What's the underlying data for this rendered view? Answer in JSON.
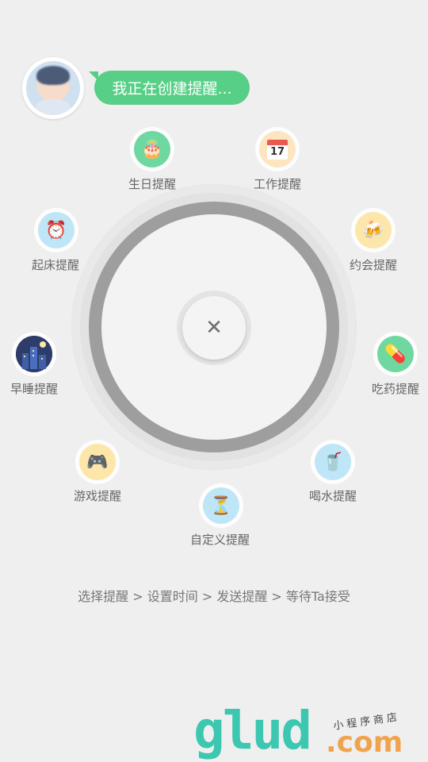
{
  "header": {
    "status_message": "我正在创建提醒..."
  },
  "dial": {
    "close_symbol": "✕"
  },
  "reminders": [
    {
      "label": "生日提醒",
      "icon": "birthday-cake-icon"
    },
    {
      "label": "工作提醒",
      "icon": "calendar-icon"
    },
    {
      "label": "起床提醒",
      "icon": "alarm-clock-icon"
    },
    {
      "label": "约会提醒",
      "icon": "beer-mugs-icon"
    },
    {
      "label": "早睡提醒",
      "icon": "night-city-icon"
    },
    {
      "label": "吃药提醒",
      "icon": "pill-icon"
    },
    {
      "label": "游戏提醒",
      "icon": "gamepad-icon"
    },
    {
      "label": "喝水提醒",
      "icon": "water-glass-icon"
    },
    {
      "label": "自定义提醒",
      "icon": "hourglass-icon"
    }
  ],
  "icons": {
    "cake": "🎂",
    "calendar": "📅",
    "alarm": "⏰",
    "beer": "🍻",
    "pill": "💊",
    "gamepad": "🎮",
    "water": "🥤",
    "hourglass": "⏳",
    "calendar_day": "17"
  },
  "steps_text": "选择提醒 > 设置时间 > 发送提醒 > 等待Ta接受",
  "watermark": {
    "brand": "glud",
    "domain": ".com",
    "tagline": "小程序商店"
  },
  "colors": {
    "background": "#efefef",
    "bubble": "#57cf86",
    "ring": "#9e9e9e"
  }
}
